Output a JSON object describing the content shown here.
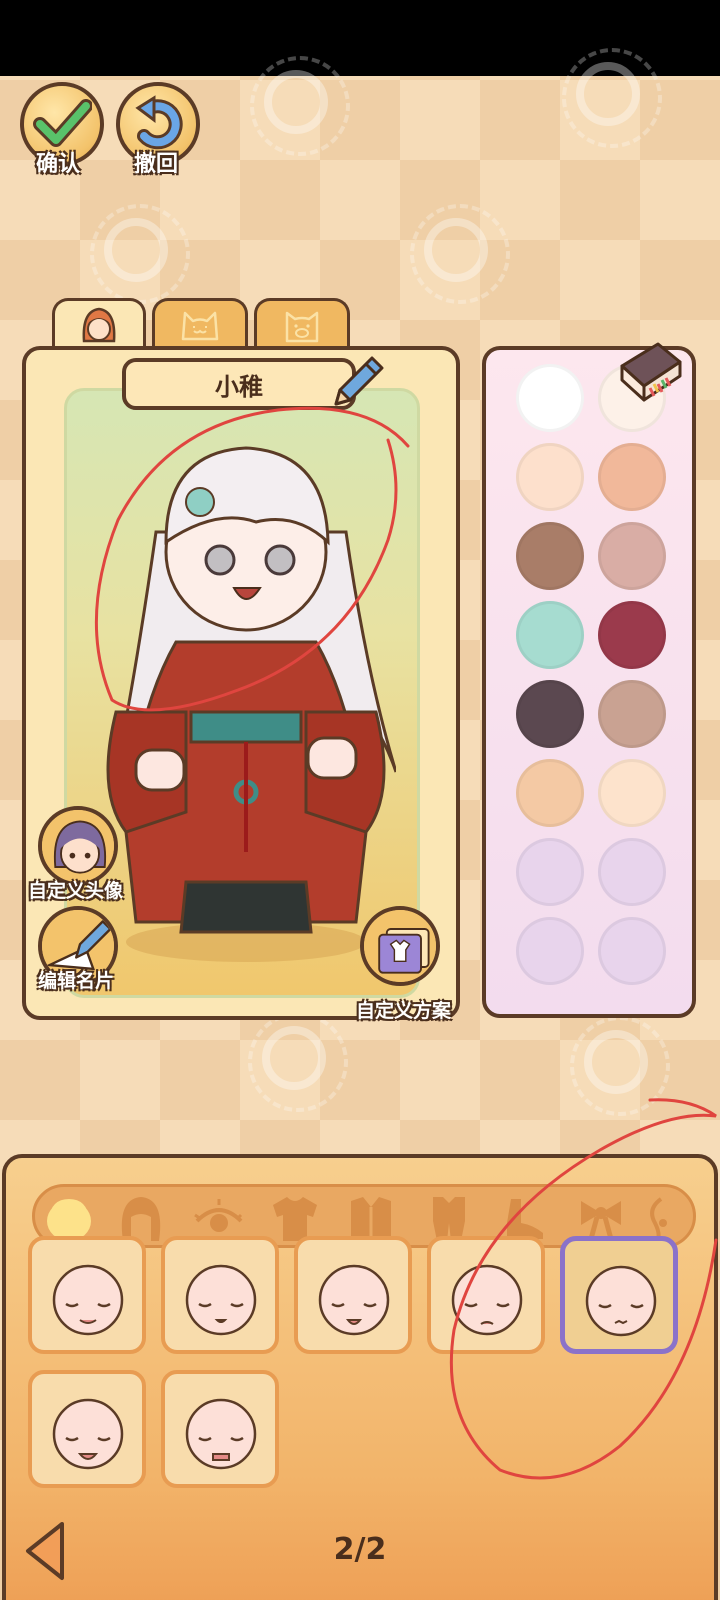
{
  "toolbar": {
    "confirm_label": "确认",
    "undo_label": "撤回"
  },
  "tabs": [
    "human-tab",
    "cat-tab",
    "dog-tab"
  ],
  "character": {
    "name": "小稚"
  },
  "side_buttons": {
    "custom_avatar": "自定义头像",
    "edit_card": "编辑名片",
    "custom_scheme": "自定义方案"
  },
  "palette": {
    "colors": [
      "#ffffff",
      "#fdf1e8",
      "#fde0cc",
      "#f1b89a",
      "#a97d68",
      "#d9ada5",
      "#a6dcd0",
      "#9b3a4c",
      "#5b4850",
      "#c9a292",
      "#f4c9a4",
      "#fde3cc",
      "#e8d4ec",
      "#e8d4ec",
      "#e8d4ec",
      "#e8d4ec"
    ]
  },
  "categories": [
    "face-shape",
    "hair",
    "eyes",
    "top",
    "coat",
    "outfit",
    "shoes",
    "bow",
    "accessory"
  ],
  "faces": {
    "count": 7,
    "selected_index": 4
  },
  "pagination": {
    "label": "2/2"
  }
}
